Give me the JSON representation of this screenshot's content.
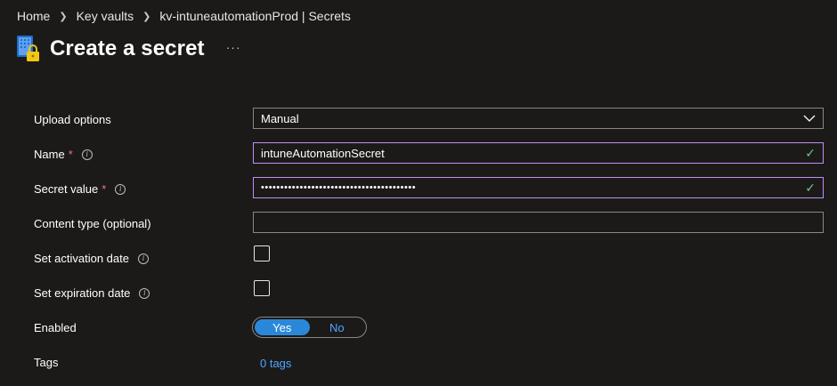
{
  "breadcrumb": {
    "items": [
      "Home",
      "Key vaults",
      "kv-intuneautomationProd | Secrets"
    ]
  },
  "header": {
    "title": "Create a secret",
    "more_label": "···"
  },
  "form": {
    "upload_options": {
      "label": "Upload options",
      "value": "Manual"
    },
    "name": {
      "label": "Name",
      "required_mark": "*",
      "value": "intuneAutomationSecret"
    },
    "secret_value": {
      "label": "Secret value",
      "required_mark": "*",
      "value": "••••••••••••••••••••••••••••••••••••••••"
    },
    "content_type": {
      "label": "Content type (optional)",
      "value": ""
    },
    "activation_date": {
      "label": "Set activation date",
      "checked": false
    },
    "expiration_date": {
      "label": "Set expiration date",
      "checked": false
    },
    "enabled": {
      "label": "Enabled",
      "options": [
        "Yes",
        "No"
      ],
      "selected": "Yes"
    },
    "tags": {
      "label": "Tags",
      "link": "0 tags"
    }
  },
  "icons": {
    "info": "info-icon",
    "check": "checkmark-icon",
    "chevron": "chevron-down-icon",
    "vault": "key-vault-lock-icon"
  },
  "colors": {
    "background": "#1b1a19",
    "accent": "#2b88d8",
    "link": "#4ea6ff",
    "required": "#f1707b",
    "valid": "#73c27f",
    "focus_border": "#c18cf5"
  }
}
